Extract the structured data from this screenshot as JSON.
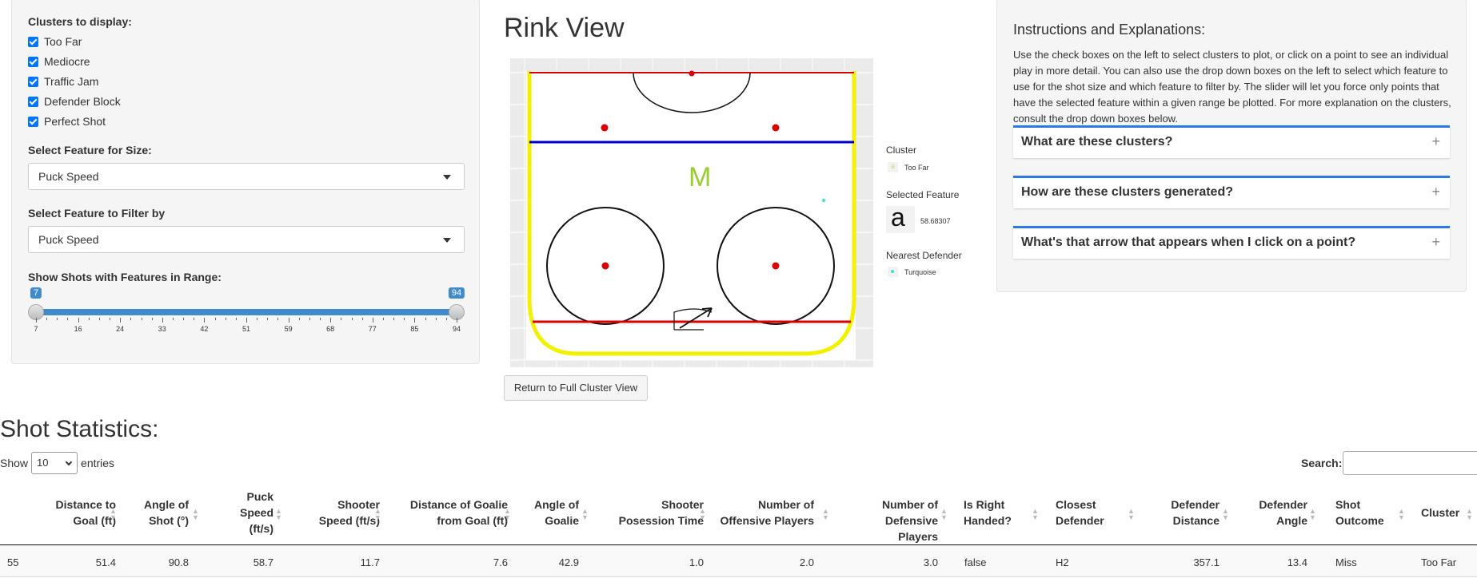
{
  "sidebar": {
    "clusters_label": "Clusters to display:",
    "clusters": [
      {
        "label": "Too Far",
        "checked": true
      },
      {
        "label": "Mediocre",
        "checked": true
      },
      {
        "label": "Traffic Jam",
        "checked": true
      },
      {
        "label": "Defender Block",
        "checked": true
      },
      {
        "label": "Perfect Shot",
        "checked": true
      }
    ],
    "size_label": "Select Feature for Size:",
    "size_value": "Puck Speed",
    "filter_label": "Select Feature to Filter by",
    "filter_value": "Puck Speed",
    "range_label": "Show Shots with Features in Range:",
    "slider": {
      "min": 7,
      "max": 94,
      "from": 7,
      "to": 94,
      "from_label": "7",
      "to_label": "94",
      "ticks": [
        "7",
        "16",
        "24",
        "33",
        "42",
        "51",
        "59",
        "68",
        "77",
        "85",
        "94"
      ]
    }
  },
  "rink": {
    "title": "Rink View",
    "marker_letter": "M",
    "legend": {
      "cluster_title": "Cluster",
      "cluster_value": "Too Far",
      "cluster_key_glyph": "a",
      "feature_title": "Selected Feature",
      "feature_glyph": "a",
      "feature_value": "58.68307",
      "defender_title": "Nearest Defender",
      "defender_value": "Turquoise"
    },
    "colors": {
      "goal_line": "#dd0000",
      "blue_line": "#0000cc",
      "boards": "#f2f200",
      "cluster_marker": "#9acd32",
      "defender": "#40e0d0"
    },
    "return_button": "Return to Full Cluster View"
  },
  "instructions": {
    "title": "Instructions and Explanations:",
    "text": "Use the check boxes on the left to select clusters to plot, or click on a point to see an individual play in more detail. You can also use the drop down boxes on the left to select which feature to use for the shot size and which feature to filter by. The slider will let you force only points that have the selected feature within a given range be plotted. For more explanation on the clusters, consult the drop down boxes below.",
    "accordions": [
      {
        "title": "What are these clusters?"
      },
      {
        "title": "How are these clusters generated?"
      },
      {
        "title": "What's that arrow that appears when I click on a point?"
      }
    ],
    "plus": "+"
  },
  "stats": {
    "title": "Shot Statistics:",
    "show_label": "Show",
    "entries_value": "10",
    "entries_label": "entries",
    "search_label": "Search:",
    "columns": [
      "Distance to Goal (ft)",
      "Angle of Shot (°)",
      "Puck Speed (ft/s)",
      "Shooter Speed (ft/s)",
      "Distance of Goalie from Goal (ft)",
      "Angle of Goalie",
      "Shooter Posession Time",
      "Number of Offensive Players",
      "Number of Defensive Players",
      "Is Right Handed?",
      "Closest Defender",
      "Defender Distance",
      "Defender Angle",
      "Shot Outcome",
      "Cluster"
    ],
    "rows": [
      {
        "id": "55",
        "cells": [
          "51.4",
          "90.8",
          "58.7",
          "11.7",
          "7.6",
          "42.9",
          "1.0",
          "2.0",
          "3.0",
          "false",
          "H2",
          "357.1",
          "13.4",
          "Miss",
          "Too Far"
        ]
      }
    ]
  }
}
